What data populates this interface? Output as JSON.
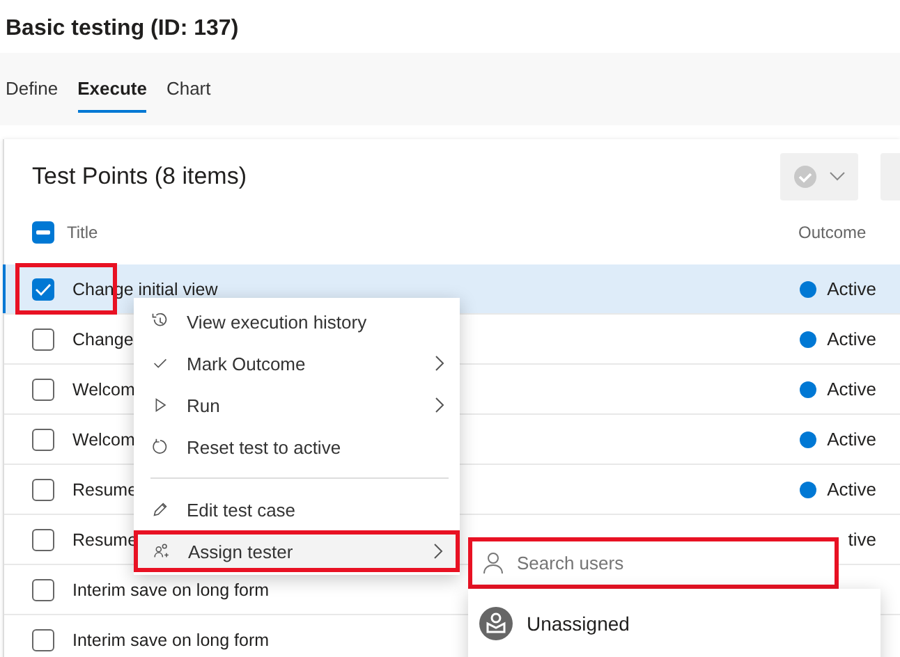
{
  "page_title": "Basic testing (ID: 137)",
  "tabs": [
    {
      "label": "Define",
      "selected": false
    },
    {
      "label": "Execute",
      "selected": true
    },
    {
      "label": "Chart",
      "selected": false
    }
  ],
  "panel": {
    "title": "Test Points (8 items)",
    "select_all_indeterminate": true,
    "columns": [
      "Title",
      "Outcome"
    ],
    "rows": [
      {
        "title": "Change initial view",
        "selected": true,
        "checked": true,
        "highlighted": true,
        "outcome": "Active",
        "color": "#0078d4"
      },
      {
        "title": "Change",
        "selected": false,
        "checked": false,
        "highlighted": false,
        "outcome": "Active",
        "color": "#0078d4"
      },
      {
        "title": "Welcom",
        "selected": false,
        "checked": false,
        "highlighted": false,
        "outcome": "Active",
        "color": "#0078d4"
      },
      {
        "title": "Welcom",
        "selected": false,
        "checked": false,
        "highlighted": false,
        "outcome": "Active",
        "color": "#0078d4"
      },
      {
        "title": "Resume",
        "selected": false,
        "checked": false,
        "highlighted": false,
        "outcome": "Active",
        "color": "#0078d4"
      },
      {
        "title": "Resume",
        "selected": false,
        "checked": false,
        "highlighted": false,
        "outcome": "tive"
      },
      {
        "title": "Interim save on long form",
        "selected": false,
        "checked": false,
        "highlighted": false
      },
      {
        "title": "Interim save on long form",
        "selected": false,
        "checked": false,
        "highlighted": false
      }
    ]
  },
  "context_menu": {
    "items": [
      {
        "kind": "item",
        "label": "View execution history",
        "submenu": false,
        "highlighted": false
      },
      {
        "kind": "item",
        "label": "Mark Outcome",
        "submenu": true,
        "highlighted": false
      },
      {
        "kind": "item",
        "label": "Run",
        "submenu": true,
        "highlighted": false
      },
      {
        "kind": "item",
        "label": "Reset test to active",
        "submenu": false,
        "highlighted": false
      },
      {
        "kind": "divider"
      },
      {
        "kind": "item",
        "label": "Edit test case",
        "submenu": false,
        "highlighted": false
      },
      {
        "kind": "item",
        "label": "Assign tester",
        "submenu": true,
        "highlighted": true
      }
    ]
  },
  "assign_popup": {
    "search": {
      "placeholder": "Search users",
      "highlighted": true
    },
    "users": [
      {
        "name": "Unassigned"
      }
    ]
  }
}
